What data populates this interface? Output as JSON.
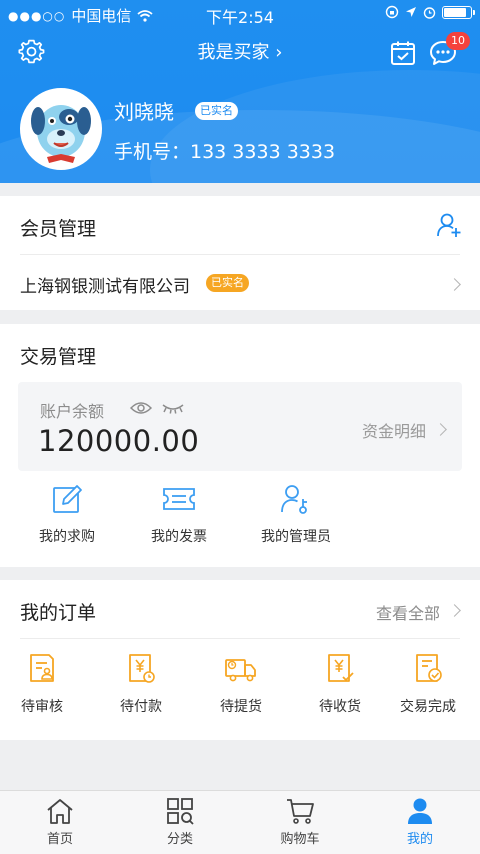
{
  "status_bar": {
    "signal_dots": "●●●○○",
    "carrier": "中国电信",
    "time": "下午2:54",
    "battery_level": 0.8
  },
  "nav": {
    "title": "我是买家 ›",
    "message_badge": "10"
  },
  "profile": {
    "name": "刘晓晓",
    "verified_tag": "已实名",
    "phone": "手机号：133 3333 3333"
  },
  "member": {
    "title": "会员管理",
    "company": "上海钢银测试有限公司",
    "company_tag": "已实名"
  },
  "trade": {
    "title": "交易管理",
    "balance_label": "账户余额",
    "balance_value": "120000.00",
    "detail_link": "资金明细",
    "tools": [
      {
        "label": "我的求购",
        "icon": "edit-icon"
      },
      {
        "label": "我的发票",
        "icon": "ticket-icon"
      },
      {
        "label": "我的管理员",
        "icon": "user-key-icon"
      }
    ]
  },
  "orders": {
    "title": "我的订单",
    "view_all": "查看全部",
    "items": [
      {
        "label": "待审核",
        "icon": "review-doc-icon"
      },
      {
        "label": "待付款",
        "icon": "yuan-doc-icon"
      },
      {
        "label": "待提货",
        "icon": "truck-icon"
      },
      {
        "label": "待收货",
        "icon": "receive-doc-icon"
      },
      {
        "label": "交易完成",
        "icon": "complete-doc-icon"
      }
    ]
  },
  "tabbar": [
    {
      "label": "首页",
      "icon": "home-icon"
    },
    {
      "label": "分类",
      "icon": "category-icon"
    },
    {
      "label": "购物车",
      "icon": "cart-icon"
    },
    {
      "label": "我的",
      "icon": "profile-icon",
      "active": true
    }
  ],
  "colors": {
    "brand": "#1d8bf0",
    "accent_orange": "#f6a623",
    "badge_red": "#f5423d"
  }
}
